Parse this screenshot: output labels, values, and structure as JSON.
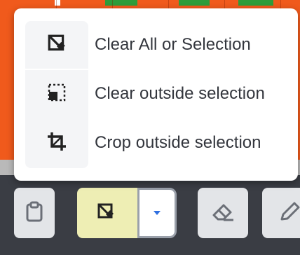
{
  "menu": {
    "items": [
      {
        "label": "Clear All or Selection",
        "icon": "clear-all-icon"
      },
      {
        "label": "Clear outside selection",
        "icon": "clear-outside-icon"
      },
      {
        "label": "Crop outside selection",
        "icon": "crop-icon"
      }
    ]
  },
  "toolbar": {
    "tools": [
      {
        "icon": "clipboard-icon"
      },
      {
        "icon": "clear-all-icon",
        "active": true
      },
      {
        "icon": "dropdown-caret-icon"
      },
      {
        "icon": "eraser-icon"
      },
      {
        "icon": "pencil-icon"
      }
    ]
  },
  "colors": {
    "canvas": "#f05a1c",
    "canvas_strip": "#2e9c3a",
    "toolbar_bg": "#3a3d44",
    "active_tool": "#eeeeb4",
    "dropdown_caret": "#2f6fe0",
    "menu_text": "#33363d"
  }
}
